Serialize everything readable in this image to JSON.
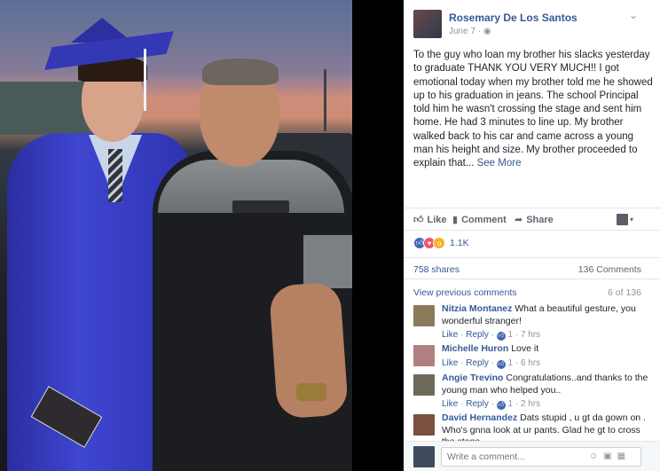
{
  "post": {
    "author": "Rosemary De Los Santos",
    "date": "June 7",
    "privacy_icon": "globe-icon",
    "text": "To the guy who loan my brother his slacks yesterday to graduate THANK YOU VERY MUCH!! I got emotional today when my brother told me he showed up to his graduation in jeans. The school Principal told him he wasn't crossing the stage and sent him home. He had 3 minutes to line up. My brother walked back to his car and came across a young man his height and size. My brother proceeded to explain that...",
    "see_more": "See More"
  },
  "actions": {
    "like": "Like",
    "comment": "Comment",
    "share": "Share"
  },
  "reactions": {
    "count": "1.1K",
    "types": [
      "like",
      "love",
      "wow"
    ]
  },
  "stats": {
    "shares": "758 shares",
    "comments": "136 Comments"
  },
  "comments_section": {
    "view_previous": "View previous comments",
    "position": "6 of 136",
    "items": [
      {
        "name": "Nitzia Montanez",
        "text": "What a beautiful gesture, you wonderful stranger!",
        "like": "Like",
        "reply": "Reply",
        "likes": "1",
        "time": "7 hrs",
        "avatar_color": "#8a7a5a"
      },
      {
        "name": "Michelle Huron",
        "text": "Love it",
        "like": "Like",
        "reply": "Reply",
        "likes": "1",
        "time": "6 hrs",
        "avatar_color": "#b08080"
      },
      {
        "name": "Angie Trevino",
        "text": "Congratulations..and thanks to the young man who helped you..",
        "like": "Like",
        "reply": "Reply",
        "likes": "1",
        "time": "2 hrs",
        "avatar_color": "#6d6a5a"
      },
      {
        "name": "David Hernandez",
        "text": "Dats stupid , u gt da gown on . Who's gnna look at ur pants. Glad he gt to cross the stage",
        "avatar_color": "#7a5040"
      }
    ]
  },
  "write_comment": {
    "placeholder": "Write a comment..."
  },
  "colors": {
    "link_blue": "#365899",
    "like_blue": "#4267b2",
    "love_red": "#f25268",
    "wow_yellow": "#f7b125"
  }
}
